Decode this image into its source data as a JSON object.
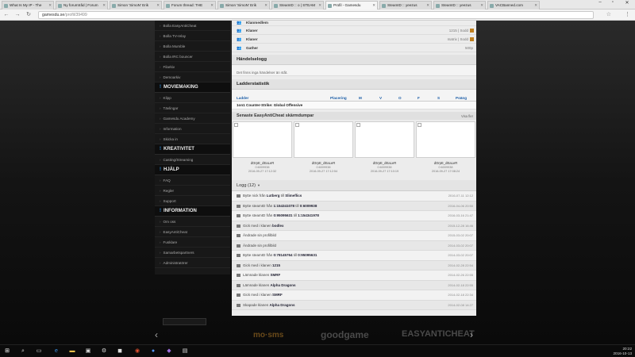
{
  "browser": {
    "tabs": [
      {
        "label": "What Is My IP - The"
      },
      {
        "label": "Ny forumtråd | Forum"
      },
      {
        "label": "Simon 'SimoN' Erik"
      },
      {
        "label": "Forum thread: THE"
      },
      {
        "label": "Simon 'SimoN' Erik"
      },
      {
        "label": "SteamID :: o | STEAM"
      },
      {
        "label": "Profil - Gamesdu"
      },
      {
        "label": "SteamID :: yeezus"
      },
      {
        "label": "SteamID :: yeezus"
      },
      {
        "label": "VACBanned.com"
      }
    ],
    "url_host": "gamesdu.se",
    "url_path": "/profil/39499"
  },
  "sidebar": {
    "items_top": [
      "Bolla EasyAntiCheat",
      "Bolla TV-relay",
      "Bolla Mumble",
      "Bolla IRC bouncer",
      "Filarkiv",
      "Demoarkiv"
    ],
    "section_moviemaking": "MOVIEMAKING",
    "items_movie": [
      "Klipp",
      "Tävlingar",
      "Gamesdu Academy",
      "Information",
      "Skicka in"
    ],
    "section_kreativitet": "KREATIVITET",
    "items_kreativitet": [
      "Casting/Streaming"
    ],
    "section_hjalp": "HJÄLP",
    "items_hjalp": [
      "FAQ",
      "Regler",
      "Support"
    ],
    "section_information": "INFORMATION",
    "items_information": [
      "Om oss",
      "EasyAntiCheat",
      "Fusklare",
      "Samarbetspartners",
      "Administratörer"
    ]
  },
  "main": {
    "top_row_label": "Klanmedlem",
    "clan_rows": [
      {
        "label": "Klaner",
        "value": "1215 | Sodd"
      },
      {
        "label": "Klaner",
        "value": "matrix | Sodd"
      },
      {
        "label": "Gather",
        "value": "500p"
      }
    ],
    "handelselogg_title": "Händelselogg",
    "handelselogg_note": "Det finns inga händelser än ståt.",
    "ladder_title": "Ladderstatistik",
    "ladder_cols": [
      "Ladder",
      "Placering",
      "M",
      "V",
      "O",
      "F",
      "S",
      "Poäng"
    ],
    "ladder_row": "1on1 Counter-Strike: Global Offensive",
    "screenshots_title": "Senaste EasyAntiCheat skärmdumpar",
    "screenshots_more": "Visa fler",
    "screenshots": [
      {
        "user": "dOrpE_dEaLeR",
        "id": "0:6009938",
        "date": "2016-09-27 17:12:32"
      },
      {
        "user": "dOrpE_dEaLeR",
        "id": "0:6009938",
        "date": "2016-09-27 17:12:54"
      },
      {
        "user": "dOrpE_dEaLeR",
        "id": "0:6009938",
        "date": "2016-09-27 17:10:19"
      },
      {
        "user": "dOrpE_dEaLeR",
        "id": "0:6009938",
        "date": "2016-09-27 17:08:24"
      }
    ],
    "log_title": "Logg (12)",
    "log": [
      {
        "text_a": "Bytte nick från ",
        "bold_a": "Lutberg",
        "text_b": " till ",
        "bold_b": "Slimeflics",
        "date": "2016-07-11 12:12"
      },
      {
        "text_a": "Bytte steamID från ",
        "bold_a": "1:154341078",
        "text_b": " till ",
        "bold_b": "0:6009938",
        "date": "2016-04-06 20:50"
      },
      {
        "text_a": "Bytte steamID från ",
        "bold_a": "0:95095631",
        "text_b": " till ",
        "bold_b": "1:154341978",
        "date": "2016-03-16 21:47"
      },
      {
        "text_a": "Gick med i klanen ",
        "bold_a": "bodlex",
        "text_b": "",
        "bold_b": "",
        "date": "2015-12-28 16:46"
      },
      {
        "text_a": "Ändrade sin profilbild",
        "bold_a": "",
        "text_b": "",
        "bold_b": "",
        "date": "2015-03-02 20:07"
      },
      {
        "text_a": "Ändrade sin profilbild",
        "bold_a": "",
        "text_b": "",
        "bold_b": "",
        "date": "2014-03-02 20:07"
      },
      {
        "text_a": "Bytte steamID från ",
        "bold_a": "0:78145764",
        "text_b": " till ",
        "bold_b": "0:95095631",
        "date": "2014-03-02 20:07"
      },
      {
        "text_a": "Gick med i klanen ",
        "bold_a": "1215",
        "text_b": "",
        "bold_b": "",
        "date": "2014-02-28 22:54"
      },
      {
        "text_a": "Lämnade klanen ",
        "bold_a": "SMRF",
        "text_b": "",
        "bold_b": "",
        "date": "2014-02-26 22:55"
      },
      {
        "text_a": "Lämnade klanen ",
        "bold_a": "Alpha Dragons",
        "text_b": "",
        "bold_b": "",
        "date": "2014-02-18 22:55"
      },
      {
        "text_a": "Gick med i klanen ",
        "bold_a": "SMRF",
        "text_b": "",
        "bold_b": "",
        "date": "2014-02-18 22:34"
      },
      {
        "text_a": "Skapade klanen ",
        "bold_a": "Alpha Dragons",
        "text_b": "",
        "bold_b": "",
        "date": "2014-02-08 14:27"
      }
    ]
  },
  "sponsors": [
    "mo·sms",
    "goodgame",
    "EASYANTICHEAT"
  ],
  "taskbar": {
    "time": "20:22",
    "date": "2016-10-13"
  }
}
